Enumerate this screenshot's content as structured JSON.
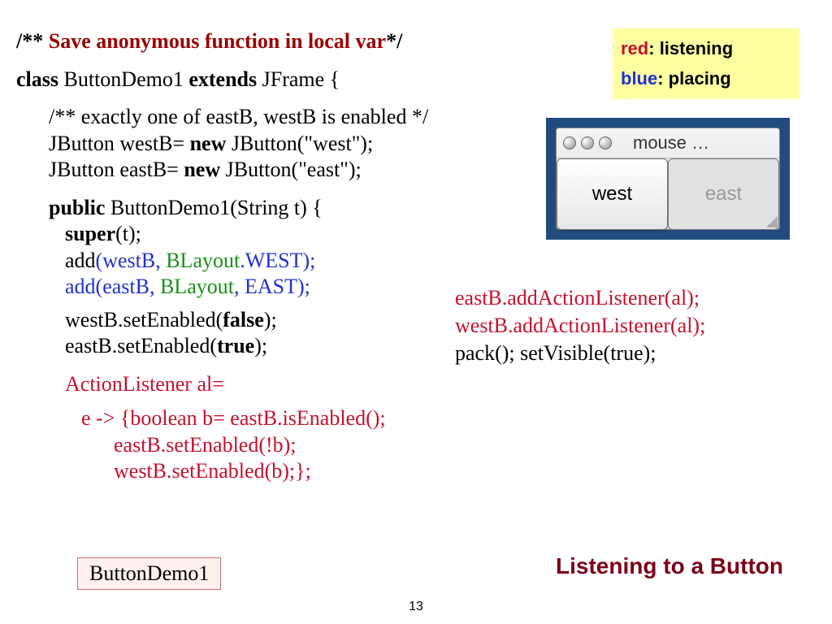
{
  "title": {
    "pre": "/** ",
    "main": "Save anonymous function in local var",
    "post": "*/"
  },
  "legend": {
    "red_key": "red",
    "red_val": ": listening",
    "blue_key": "blue",
    "blue_val": ": placing"
  },
  "code": {
    "l1a": "class",
    "l1b": " ButtonDemo1 ",
    "l1c": "extends",
    "l1d": " JFrame {",
    "l2": "/** exactly one of eastB, westB is enabled */",
    "l3a": "JButton westB= ",
    "l3b": "new",
    "l3c": " JButton(\"west\");",
    "l4a": "JButton eastB= ",
    "l4b": "new",
    "l4c": " JButton(\"east\");",
    "l5a": "public",
    "l5b": " ButtonDemo1(String t) {",
    "l6a": "super",
    "l6b": "(t);",
    "l7a": "add",
    "l7b": "(westB, ",
    "l7c": "BLayout",
    "l7d": ".WEST);",
    "l8": "add(eastB, ",
    "l8b": "BLayout",
    "l8c": ", EAST);",
    "l9a": "westB.setEnabled(",
    "l9b": "false",
    "l9c": ");",
    "l10a": "eastB.setEnabled(",
    "l10b": "true",
    "l10c": ");",
    "l11": "ActionListener al=",
    "l12": "e -> {boolean b= eastB.isEnabled();",
    "l13": "eastB.setEnabled(!b);",
    "l14": "westB.setEnabled(b);};"
  },
  "right": {
    "r1": "eastB.addActionListener(al);",
    "r2": "westB.addActionListener(al);",
    "r3": "pack(); setVisible(true);"
  },
  "mock": {
    "title": "mouse …",
    "west": "west",
    "east": "east"
  },
  "footer": {
    "title": "Listening to a Button",
    "file": "ButtonDemo1",
    "page": "13"
  }
}
